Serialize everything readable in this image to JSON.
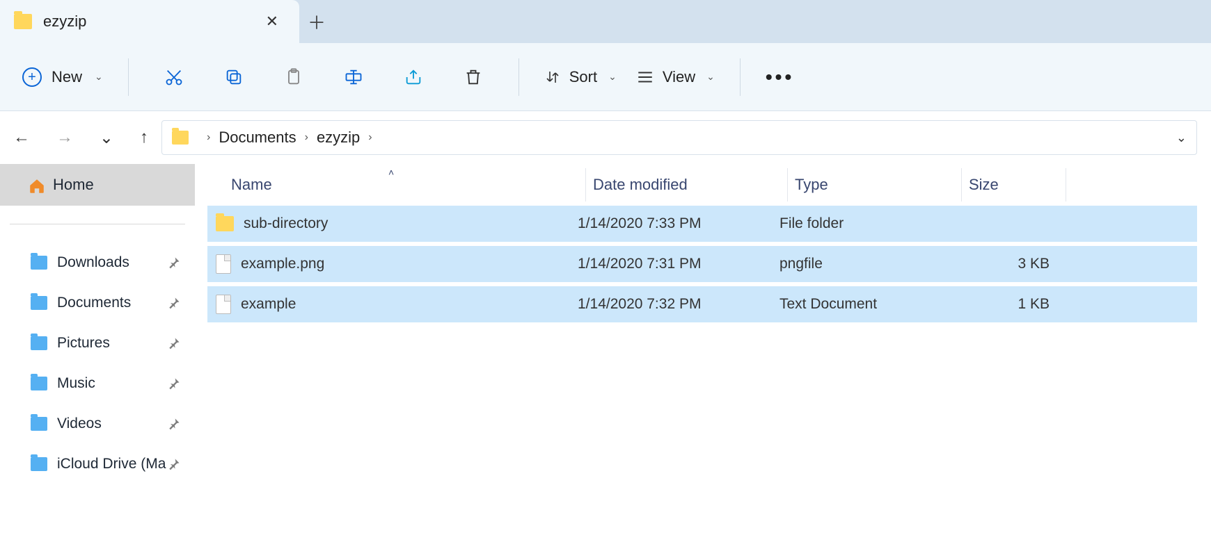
{
  "tab": {
    "title": "ezyzip"
  },
  "toolbar": {
    "new_label": "New",
    "sort_label": "Sort",
    "view_label": "View"
  },
  "breadcrumb": {
    "items": [
      "Documents",
      "ezyzip"
    ]
  },
  "sidebar": {
    "home_label": "Home",
    "items": [
      {
        "label": "Downloads"
      },
      {
        "label": "Documents"
      },
      {
        "label": "Pictures"
      },
      {
        "label": "Music"
      },
      {
        "label": "Videos"
      },
      {
        "label": "iCloud Drive (Ma"
      }
    ]
  },
  "columns": {
    "name": "Name",
    "date": "Date modified",
    "type": "Type",
    "size": "Size"
  },
  "rows": [
    {
      "icon": "folder",
      "name": "sub-directory",
      "date": "1/14/2020 7:33 PM",
      "type": "File folder",
      "size": ""
    },
    {
      "icon": "file",
      "name": "example.png",
      "date": "1/14/2020 7:31 PM",
      "type": "pngfile",
      "size": "3 KB"
    },
    {
      "icon": "file",
      "name": "example",
      "date": "1/14/2020 7:32 PM",
      "type": "Text Document",
      "size": "1 KB"
    }
  ]
}
